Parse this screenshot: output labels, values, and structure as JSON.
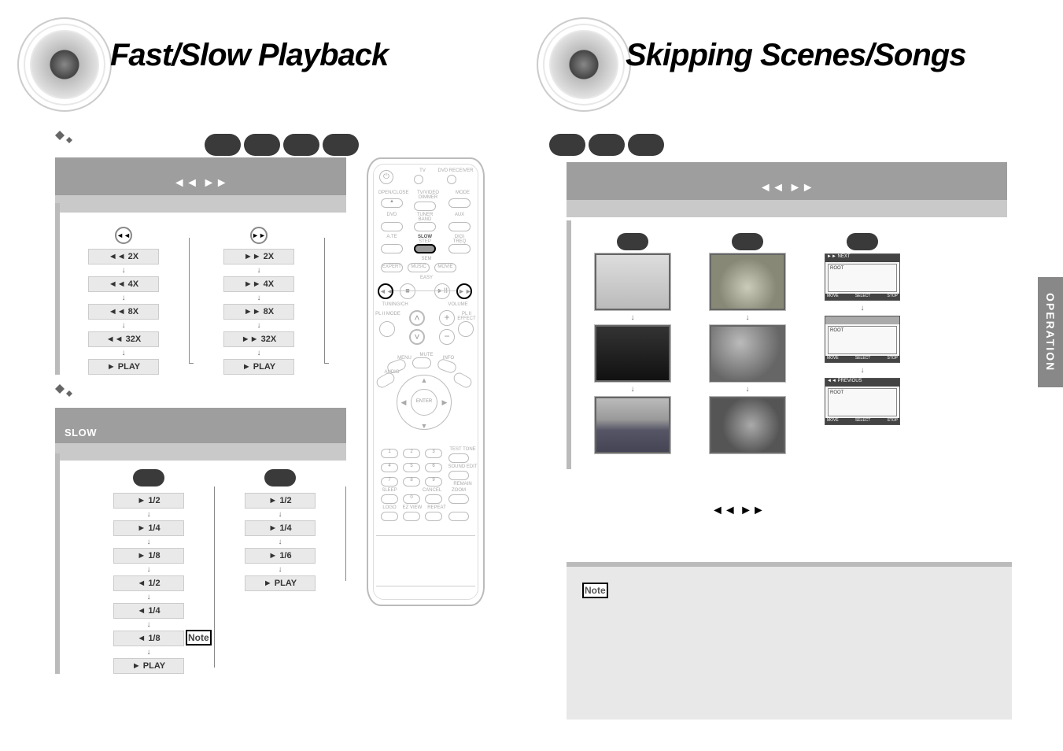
{
  "left": {
    "title": "Fast/Slow Playback",
    "fast": {
      "header_icons": "◄◄ ►►",
      "left_col": [
        "◄◄ 2X",
        "◄◄ 4X",
        "◄◄ 8X",
        "◄◄ 32X",
        "► PLAY"
      ],
      "right_col": [
        "►► 2X",
        "►► 4X",
        "►► 8X",
        "►► 32X",
        "► PLAY"
      ]
    },
    "slow": {
      "header_label": "SLOW",
      "left_col": [
        "► 1/2",
        "► 1/4",
        "► 1/8",
        "◄  1/2",
        "◄  1/4",
        "◄  1/8",
        "► PLAY"
      ],
      "right_col": [
        "► 1/2",
        "► 1/4",
        "► 1/6",
        "► PLAY"
      ]
    },
    "note_label": "Note"
  },
  "right": {
    "title": "Skipping Scenes/Songs",
    "skip_header_icons": "◄◄ ►►",
    "mp3": {
      "next_label": "►► NEXT",
      "prev_label": "◄◄ PREVIOUS",
      "root_label": "ROOT",
      "foot_move": "MOVE",
      "foot_select": "SELECT",
      "foot_stop": "STOP"
    },
    "bottom_icons": "◄◄ ►►",
    "note_label": "Note"
  },
  "side_tab": "OPERATION",
  "remote": {
    "brand_tv": "TV",
    "brand_rcv": "DVD RECEIVER",
    "open_close": "OPEN/CLOSE",
    "tvvideo": "TV/VIDEO",
    "dimmer": "DIMMER",
    "mode": "MODE",
    "dvd": "DVD",
    "tuner": "TUNER",
    "band": "BAND",
    "aux": "AUX",
    "ate": "A.TE",
    "slow": "SLOW",
    "step": "STEP",
    "dig": "DIGI TREQ",
    "sem": "SEM",
    "expert": "EXPERT",
    "movie": "MOVIE",
    "music": "MUSIC",
    "easy": "EASY",
    "tuning": "TUNING/CH",
    "volume": "VOLUME",
    "pl2m": "PL II MODE",
    "pl2e": "PL II EFFECT",
    "menu": "MENU",
    "info": "INFO",
    "audio": "AUDIO",
    "enter": "ENTER",
    "mute": "MUTE",
    "testtone": "TEST TONE",
    "soundedit": "SOUND EDIT",
    "sleep": "SLEEP",
    "cancel": "CANCEL",
    "zoom": "ZOOM",
    "logo": "LOGO",
    "ezview": "EZ VIEW",
    "repeat": "REPEAT",
    "remain": "REMAIN"
  }
}
